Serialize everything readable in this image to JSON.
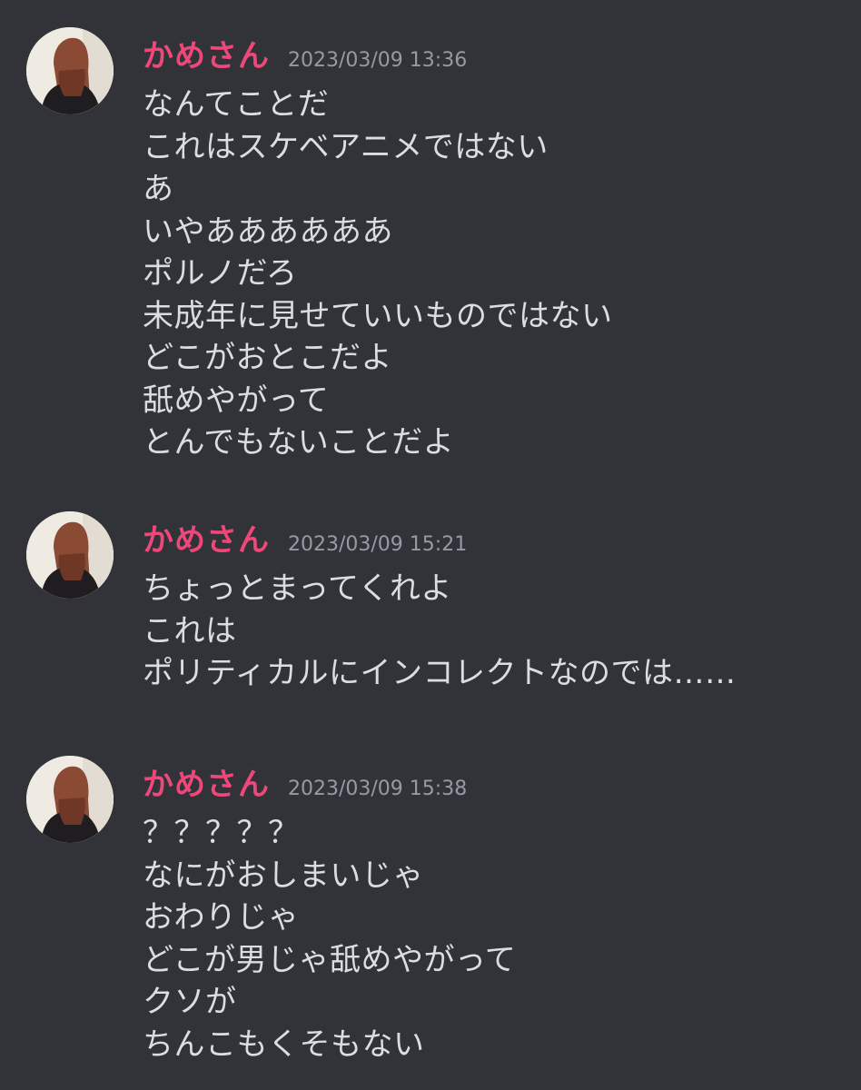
{
  "theme": {
    "background": "#313338",
    "username_color": "#f0477a",
    "text_color": "#dbdee1",
    "timestamp_color": "#949ba4"
  },
  "messages": [
    {
      "username": "かめさん",
      "timestamp": "2023/03/09 13:36",
      "avatar_icon": "user-avatar-photo",
      "lines": [
        "なんてことだ",
        "これはスケベアニメではない",
        "あ",
        "いやああああああ",
        "ポルノだろ",
        "未成年に見せていいものではない",
        "どこがおとこだよ",
        "舐めやがって",
        "とんでもないことだよ"
      ]
    },
    {
      "username": "かめさん",
      "timestamp": "2023/03/09 15:21",
      "avatar_icon": "user-avatar-photo",
      "lines": [
        "ちょっとまってくれよ",
        "これは",
        "ポリティカルにインコレクトなのでは……"
      ]
    },
    {
      "username": "かめさん",
      "timestamp": "2023/03/09 15:38",
      "avatar_icon": "user-avatar-photo",
      "lines": [
        "？？？？？",
        "なにがおしまいじゃ",
        "おわりじゃ",
        "どこが男じゃ舐めやがって",
        "クソが",
        "ちんこもくそもない"
      ]
    }
  ]
}
